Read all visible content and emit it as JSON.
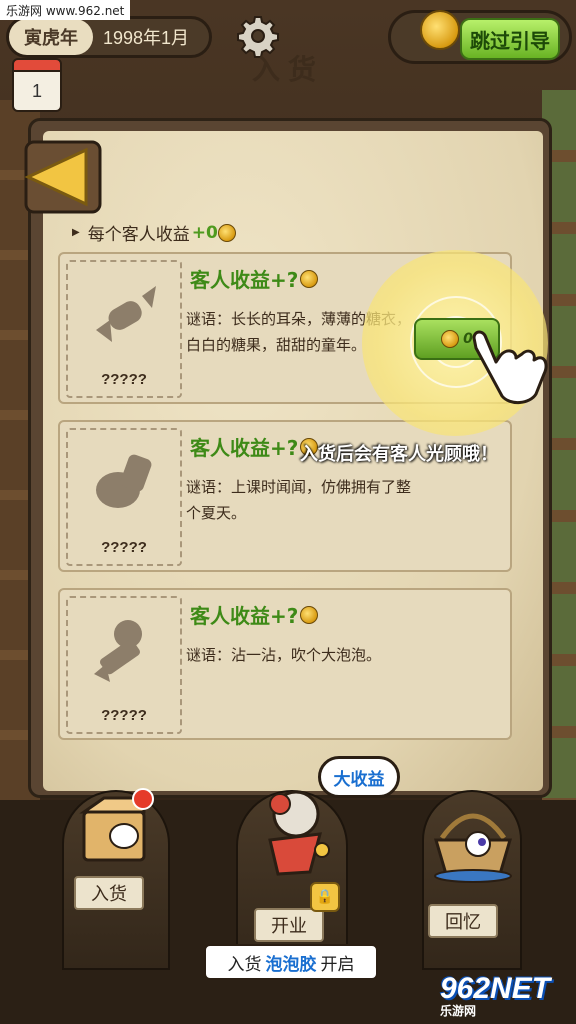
{
  "watermark": {
    "top": "乐游网 www.962.net",
    "bottom_logo": "962NET",
    "bottom_site": "乐游网"
  },
  "topbar": {
    "year_animal": "寅虎年",
    "date": "1998年1月",
    "calendar_day": "1",
    "skip_label": "跳过引导"
  },
  "panel": {
    "title": "入货",
    "income_line_label": "每个客人收益",
    "income_line_bonus": "+0",
    "cards": [
      {
        "title": "客人收益+?",
        "desc": "谜语：长长的耳朵，薄薄的糖衣，白白的糖果，甜甜的童年。",
        "qs": "?????"
      },
      {
        "title": "客人收益+?",
        "desc": "谜语：上课时闻闻，仿佛拥有了整个夏天。",
        "qs": "?????"
      },
      {
        "title": "客人收益+?",
        "desc": "谜语：沾一沾，吹个大泡泡。",
        "qs": "?????"
      }
    ],
    "collect_value": "0"
  },
  "tutorial": {
    "tip": "入货后会有客人光顾哦！"
  },
  "bottom": {
    "restock_label": "入货",
    "open_label": "开业",
    "memory_label": "回忆",
    "bubble": "大收益",
    "unlock_prefix": "入货",
    "unlock_item": "泡泡胶",
    "unlock_suffix": "开启"
  },
  "colors": {
    "accent_green": "#69b324",
    "title_green": "#3e8a17",
    "highlight_blue": "#1a6fd0",
    "badge_red": "#e53b2a"
  }
}
